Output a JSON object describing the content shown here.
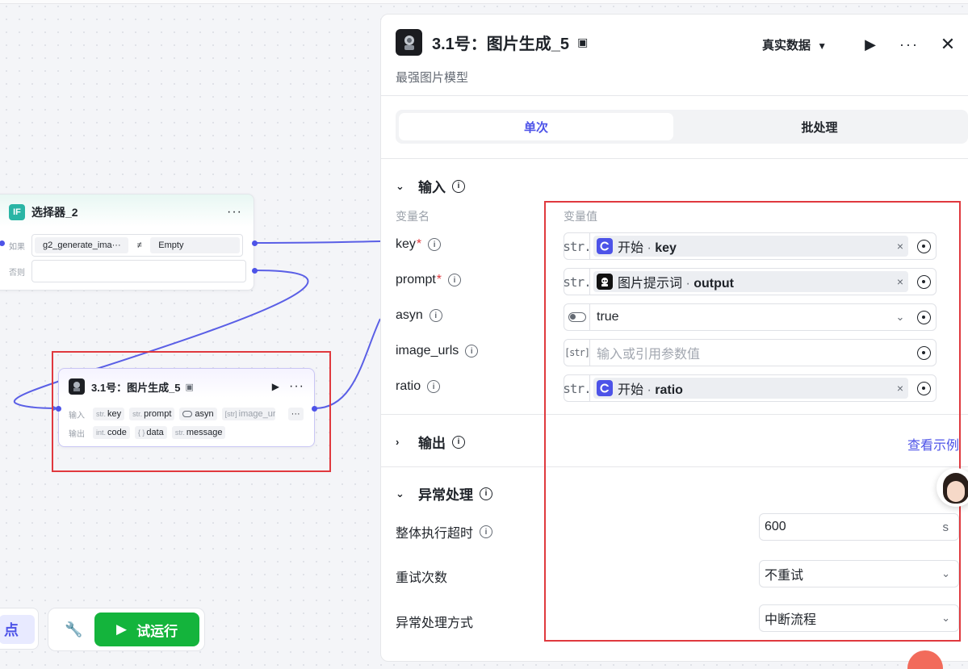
{
  "canvas": {
    "selector_node": {
      "title": "选择器_2",
      "if_badge": "IF",
      "more": "···",
      "if_label": "如果",
      "if_left": "g2_generate_ima···",
      "operator": "≠",
      "if_right": "Empty",
      "else_label": "否则"
    },
    "image_node": {
      "title": "3.1号：图片生成_5",
      "more": "···",
      "input_label": "输入",
      "output_label": "输出",
      "inputs": [
        {
          "type": "str.",
          "name": "key"
        },
        {
          "type": "str.",
          "name": "prompt"
        },
        {
          "type": "toggle",
          "name": "asyn"
        },
        {
          "type": "[str]",
          "name": "image_url"
        }
      ],
      "inputs_more": "···",
      "outputs": [
        {
          "type": "int.",
          "name": "code"
        },
        {
          "type": "{ }",
          "name": "data"
        },
        {
          "type": "str.",
          "name": "message"
        }
      ]
    },
    "toolbar": {
      "node_label": "点",
      "run_label": "试运行"
    }
  },
  "panel": {
    "title": "3.1号：图片生成_5",
    "subtitle": "最强图片模型",
    "data_mode": "真实数据",
    "tabs": [
      {
        "label": "单次",
        "active": true
      },
      {
        "label": "批处理",
        "active": false
      }
    ],
    "input_section": {
      "title": "输入",
      "col_name": "变量名",
      "col_value": "变量值",
      "params": [
        {
          "name": "key",
          "required": true,
          "type": "str.",
          "kind": "ref",
          "source": "开始",
          "sep": " · ",
          "var": "key"
        },
        {
          "name": "prompt",
          "required": true,
          "type": "str.",
          "kind": "ref",
          "source": "图片提示词",
          "sep": " · ",
          "var": "output"
        },
        {
          "name": "asyn",
          "required": false,
          "type": "toggle",
          "kind": "select",
          "value": "true"
        },
        {
          "name": "image_urls",
          "required": false,
          "type": "[str]",
          "kind": "empty",
          "placeholder": "输入或引用参数值"
        },
        {
          "name": "ratio",
          "required": false,
          "type": "str.",
          "kind": "ref",
          "source": "开始",
          "sep": " · ",
          "var": "ratio"
        }
      ]
    },
    "output_section": {
      "title": "输出",
      "example_link": "查看示例"
    },
    "error_section": {
      "title": "异常处理",
      "timeout_label": "整体执行超时",
      "timeout_value": "600",
      "timeout_unit": "s",
      "retry_label": "重试次数",
      "retry_value": "不重试",
      "method_label": "异常处理方式",
      "method_value": "中断流程"
    }
  },
  "colors": {
    "accent": "#4d53e8",
    "run_green": "#14b43c",
    "highlight_red": "#e0393e"
  }
}
